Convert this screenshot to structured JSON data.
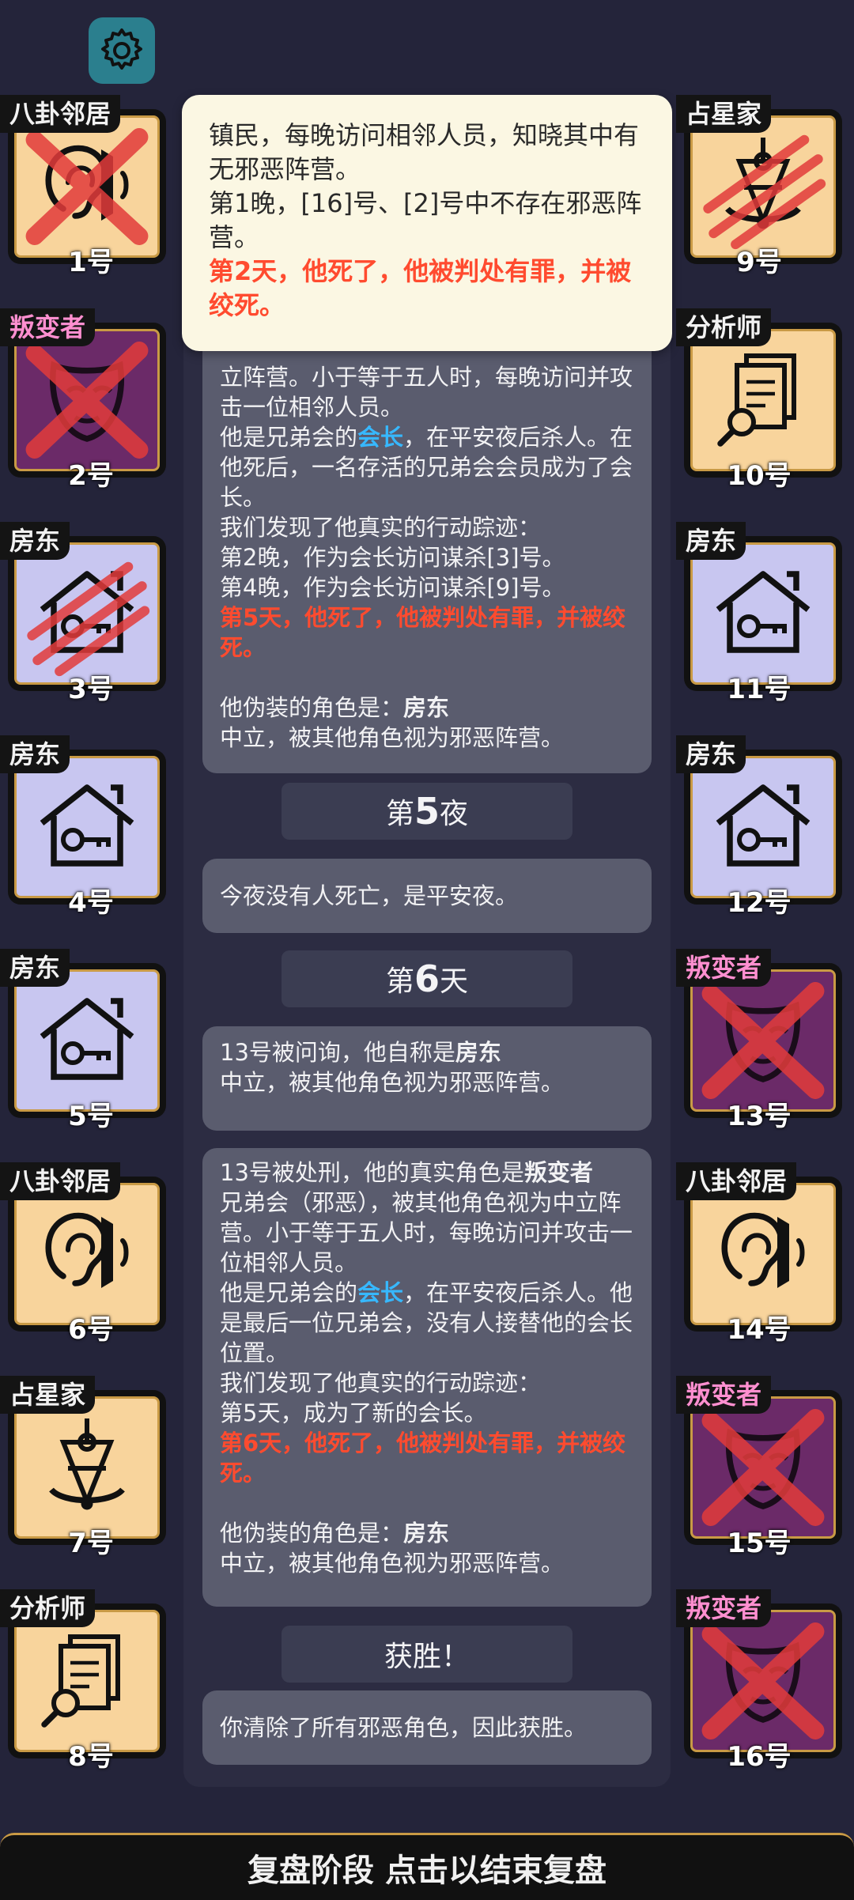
{
  "tooltip": {
    "line1": "镇民，每晚访问相邻人员，知晓其中有无邪恶阵营。",
    "line2": "第1晚，[16]号、[2]号中不存在邪恶阵营。",
    "red": "第2天，他死了，他被判处有罪，并被绞死。"
  },
  "log": {
    "card1": {
      "partial": "立阵营。小于等于五人时，每晚访问并攻击一位相邻人员。",
      "a_pre": "他是兄弟会的",
      "a_blue": "会长",
      "a_post": "，在平安夜后杀人。在他死后，一名存活的兄弟会会员成为了会长。",
      "trail": "我们发现了他真实的行动踪迹：",
      "t1": "第2晚，作为会长访问谋杀[3]号。",
      "t2": "第4晚，作为会长访问谋杀[9]号。",
      "red": "第5天，他死了，他被判处有罪，并被绞死。",
      "disguise_pre": "他伪装的角色是：",
      "disguise_role": "房东",
      "disguise_desc": "中立，被其他角色视为邪恶阵营。"
    },
    "night5": {
      "pre": "第",
      "num": "5",
      "post": "夜"
    },
    "night5_text": "今夜没有人死亡，是平安夜。",
    "day6": {
      "pre": "第",
      "num": "6",
      "post": "天"
    },
    "claim": {
      "pre": "13号被问询，他自称是",
      "role": "房东",
      "desc": "中立，被其他角色视为邪恶阵营。"
    },
    "card2": {
      "exec_pre": "13号被处刑，他的真实角色是",
      "exec_role": "叛变者",
      "exec_desc": "兄弟会（邪恶），被其他角色视为中立阵营。小于等于五人时，每晚访问并攻击一位相邻人员。",
      "a_pre": "他是兄弟会的",
      "a_blue": "会长",
      "a_post": "，在平安夜后杀人。他是最后一位兄弟会，没有人接替他的会长位置。",
      "trail": "我们发现了他真实的行动踪迹：",
      "t1": "第5天，成为了新的会长。",
      "red": "第6天，他死了，他被判处有罪，并被绞死。",
      "disguise_pre": "他伪装的角色是：",
      "disguise_role": "房东",
      "disguise_desc": "中立，被其他角色视为邪恶阵营。"
    },
    "victory": "获胜！",
    "victory_text": "你清除了所有邪恶角色，因此获胜。"
  },
  "players_left": [
    {
      "role": "八卦邻居",
      "num": "1号",
      "icon": "ear-icon",
      "dead": "x"
    },
    {
      "role": "叛变者",
      "num": "2号",
      "icon": "mask-icon",
      "dead": "x"
    },
    {
      "role": "房东",
      "num": "3号",
      "icon": "house-key-icon",
      "dead": "claw"
    },
    {
      "role": "房东",
      "num": "4号",
      "icon": "house-key-icon",
      "dead": "none"
    },
    {
      "role": "房东",
      "num": "5号",
      "icon": "house-key-icon",
      "dead": "none"
    },
    {
      "role": "八卦邻居",
      "num": "6号",
      "icon": "ear-icon",
      "dead": "none"
    },
    {
      "role": "占星家",
      "num": "7号",
      "icon": "sextant-icon",
      "dead": "none"
    },
    {
      "role": "分析师",
      "num": "8号",
      "icon": "documents-icon",
      "dead": "none"
    }
  ],
  "players_right": [
    {
      "role": "占星家",
      "num": "9号",
      "icon": "sextant-icon",
      "dead": "claw"
    },
    {
      "role": "分析师",
      "num": "10号",
      "icon": "documents-icon",
      "dead": "none"
    },
    {
      "role": "房东",
      "num": "11号",
      "icon": "house-key-icon",
      "dead": "none"
    },
    {
      "role": "房东",
      "num": "12号",
      "icon": "house-key-icon",
      "dead": "none"
    },
    {
      "role": "叛变者",
      "num": "13号",
      "icon": "mask-icon",
      "dead": "x"
    },
    {
      "role": "八卦邻居",
      "num": "14号",
      "icon": "ear-icon",
      "dead": "none"
    },
    {
      "role": "叛变者",
      "num": "15号",
      "icon": "mask-icon",
      "dead": "x"
    },
    {
      "role": "叛变者",
      "num": "16号",
      "icon": "mask-icon",
      "dead": "x"
    }
  ],
  "bottom_bar": "复盘阶段 点击以结束复盘",
  "colors": {
    "red_text": "#ff4b2f",
    "blue_text": "#37b8ff",
    "traitor_role": "#ff8fd0",
    "gold_border": "#c99a45"
  }
}
